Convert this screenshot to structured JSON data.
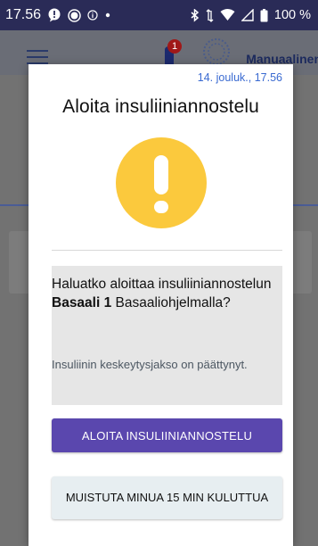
{
  "status_bar": {
    "time": "17.56",
    "battery": "100 %",
    "icons": [
      "alert-bubble-icon",
      "record-icon",
      "info-circle-icon",
      "dot-icon",
      "bluetooth-icon",
      "data-arrows-icon",
      "wifi-icon",
      "signal-icon",
      "battery-icon"
    ]
  },
  "app": {
    "mode_label": "Manuaalinen",
    "notification_count": "1"
  },
  "dialog": {
    "timestamp": "14. jouluk., 17.56",
    "title": "Aloita insuliiniannostelu",
    "icon": "warning-icon",
    "message_prefix": "Haluatko aloittaa insuliiniannostelun ",
    "message_bold": "Basaali 1",
    "message_suffix": " Basaaliohjelmalla?",
    "sub_message": "Insuliinin keskeytysjakso on päättynyt.",
    "primary_button": "ALOITA INSULIINIANNOSTELU",
    "secondary_button": "MUISTUTA MINUA 15 MIN KULUTTUA"
  },
  "colors": {
    "status_bar": "#2a2b57",
    "accent": "#5a47ae",
    "warning": "#fbc93d",
    "link": "#3a6ad1"
  }
}
